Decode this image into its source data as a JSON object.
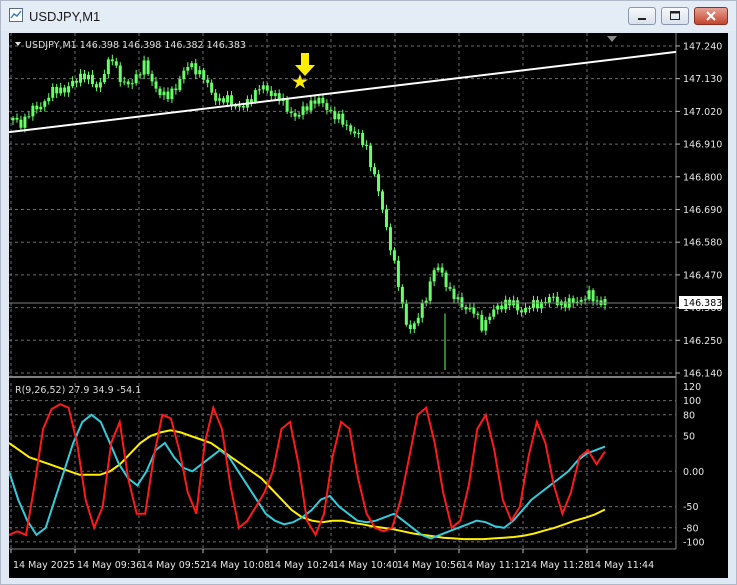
{
  "window": {
    "title": "USDJPY,M1",
    "minimize_icon": "minimize-icon",
    "maximize_icon": "maximize-icon",
    "close_icon": "close-icon"
  },
  "main_chart": {
    "header": "USDJPY,M1  146.398 146.398 146.382 146.383",
    "current_price": "146.383",
    "price_labels": [
      "147.240",
      "147.130",
      "147.020",
      "146.910",
      "146.800",
      "146.690",
      "146.580",
      "146.470",
      "146.360",
      "146.250",
      "146.140"
    ],
    "colors": {
      "background": "#000000",
      "candles": "#66ff66",
      "trendline": "#ffffff",
      "arrow": "#ffee00",
      "star": "#ffee00",
      "grid": "#6b6b6b"
    }
  },
  "indicator": {
    "label": "R(9,26,52) 27.9 34.9 -54.1",
    "levels": [
      "120",
      "100",
      "80",
      "50",
      "0.00",
      "-50",
      "-80",
      "-100"
    ],
    "colors": {
      "fast": "#ff1a1a",
      "mid": "#33ccdd",
      "slow": "#ffee00"
    }
  },
  "time_axis": {
    "labels": [
      "14 May 2025",
      "14 May 09:36",
      "14 May 09:52",
      "14 May 10:08",
      "14 May 10:24",
      "14 May 10:40",
      "14 May 10:56",
      "14 May 11:12",
      "14 May 11:28",
      "14 May 11:44"
    ]
  },
  "chart_data": {
    "type": "candlestick",
    "symbol": "USDJPY",
    "timeframe": "M1",
    "ohlc_last": {
      "open": 146.398,
      "high": 146.398,
      "low": 146.382,
      "close": 146.383
    },
    "ylim": [
      146.14,
      147.25
    ],
    "close_path": [
      146.99,
      146.98,
      147.01,
      147.03,
      147.05,
      147.08,
      147.1,
      147.09,
      147.12,
      147.15,
      147.12,
      147.1,
      147.16,
      147.2,
      147.13,
      147.1,
      147.14,
      147.18,
      147.12,
      147.09,
      147.06,
      147.1,
      147.14,
      147.18,
      147.16,
      147.12,
      147.08,
      147.05,
      147.06,
      147.04,
      147.03,
      147.07,
      147.1,
      147.09,
      147.08,
      147.05,
      147.02,
      147.0,
      147.03,
      147.06,
      147.05,
      147.03,
      147.0,
      146.98,
      146.96,
      146.93,
      146.9,
      146.8,
      146.7,
      146.58,
      146.45,
      146.32,
      146.28,
      146.35,
      146.42,
      146.5,
      146.47,
      146.4,
      146.38,
      146.36,
      146.34,
      146.3,
      146.33,
      146.36,
      146.38,
      146.37,
      146.35,
      146.36,
      146.37,
      146.38,
      146.39,
      146.38,
      146.37,
      146.38,
      146.39,
      146.4,
      146.38,
      146.383
    ],
    "trendline": {
      "from": 146.95,
      "to": 147.22
    },
    "indicator_name": "R(9,26,52)",
    "indicator_values": {
      "fast": 27.9,
      "mid": 34.9,
      "slow": -54.1
    },
    "indicator_ylim": [
      -110,
      125
    ],
    "indicator_series": {
      "fast": [
        -90,
        -85,
        -90,
        -20,
        60,
        88,
        95,
        90,
        40,
        -40,
        -80,
        -50,
        40,
        70,
        -10,
        -60,
        -60,
        20,
        80,
        75,
        30,
        -30,
        -60,
        40,
        90,
        60,
        -20,
        -80,
        -70,
        -50,
        -30,
        0,
        60,
        70,
        10,
        -70,
        -90,
        -60,
        20,
        70,
        60,
        -10,
        -60,
        -80,
        -85,
        -80,
        -40,
        20,
        80,
        90,
        40,
        -30,
        -80,
        -70,
        -20,
        60,
        80,
        30,
        -40,
        -70,
        -50,
        20,
        70,
        40,
        -20,
        -60,
        -30,
        20,
        30,
        10,
        27.9
      ],
      "mid": [
        0,
        -40,
        -70,
        -90,
        -80,
        -40,
        0,
        40,
        70,
        80,
        70,
        40,
        10,
        -10,
        -20,
        0,
        30,
        40,
        20,
        5,
        0,
        10,
        20,
        30,
        20,
        0,
        -20,
        -40,
        -60,
        -70,
        -75,
        -72,
        -65,
        -55,
        -40,
        -35,
        -50,
        -60,
        -70,
        -72,
        -70,
        -65,
        -60,
        -70,
        -80,
        -90,
        -95,
        -90,
        -85,
        -80,
        -75,
        -70,
        -72,
        -78,
        -80,
        -70,
        -55,
        -40,
        -30,
        -20,
        -10,
        0,
        15,
        25,
        30,
        34.9
      ],
      "slow": [
        40,
        30,
        20,
        15,
        10,
        5,
        0,
        -5,
        -5,
        -5,
        0,
        10,
        25,
        40,
        50,
        55,
        58,
        55,
        50,
        45,
        40,
        30,
        20,
        10,
        0,
        -10,
        -25,
        -40,
        -55,
        -65,
        -70,
        -72,
        -70,
        -70,
        -73,
        -75,
        -78,
        -80,
        -82,
        -85,
        -88,
        -90,
        -92,
        -94,
        -95,
        -96,
        -96,
        -96,
        -95,
        -94,
        -93,
        -91,
        -88,
        -84,
        -80,
        -75,
        -70,
        -66,
        -61,
        -54.1
      ]
    }
  }
}
